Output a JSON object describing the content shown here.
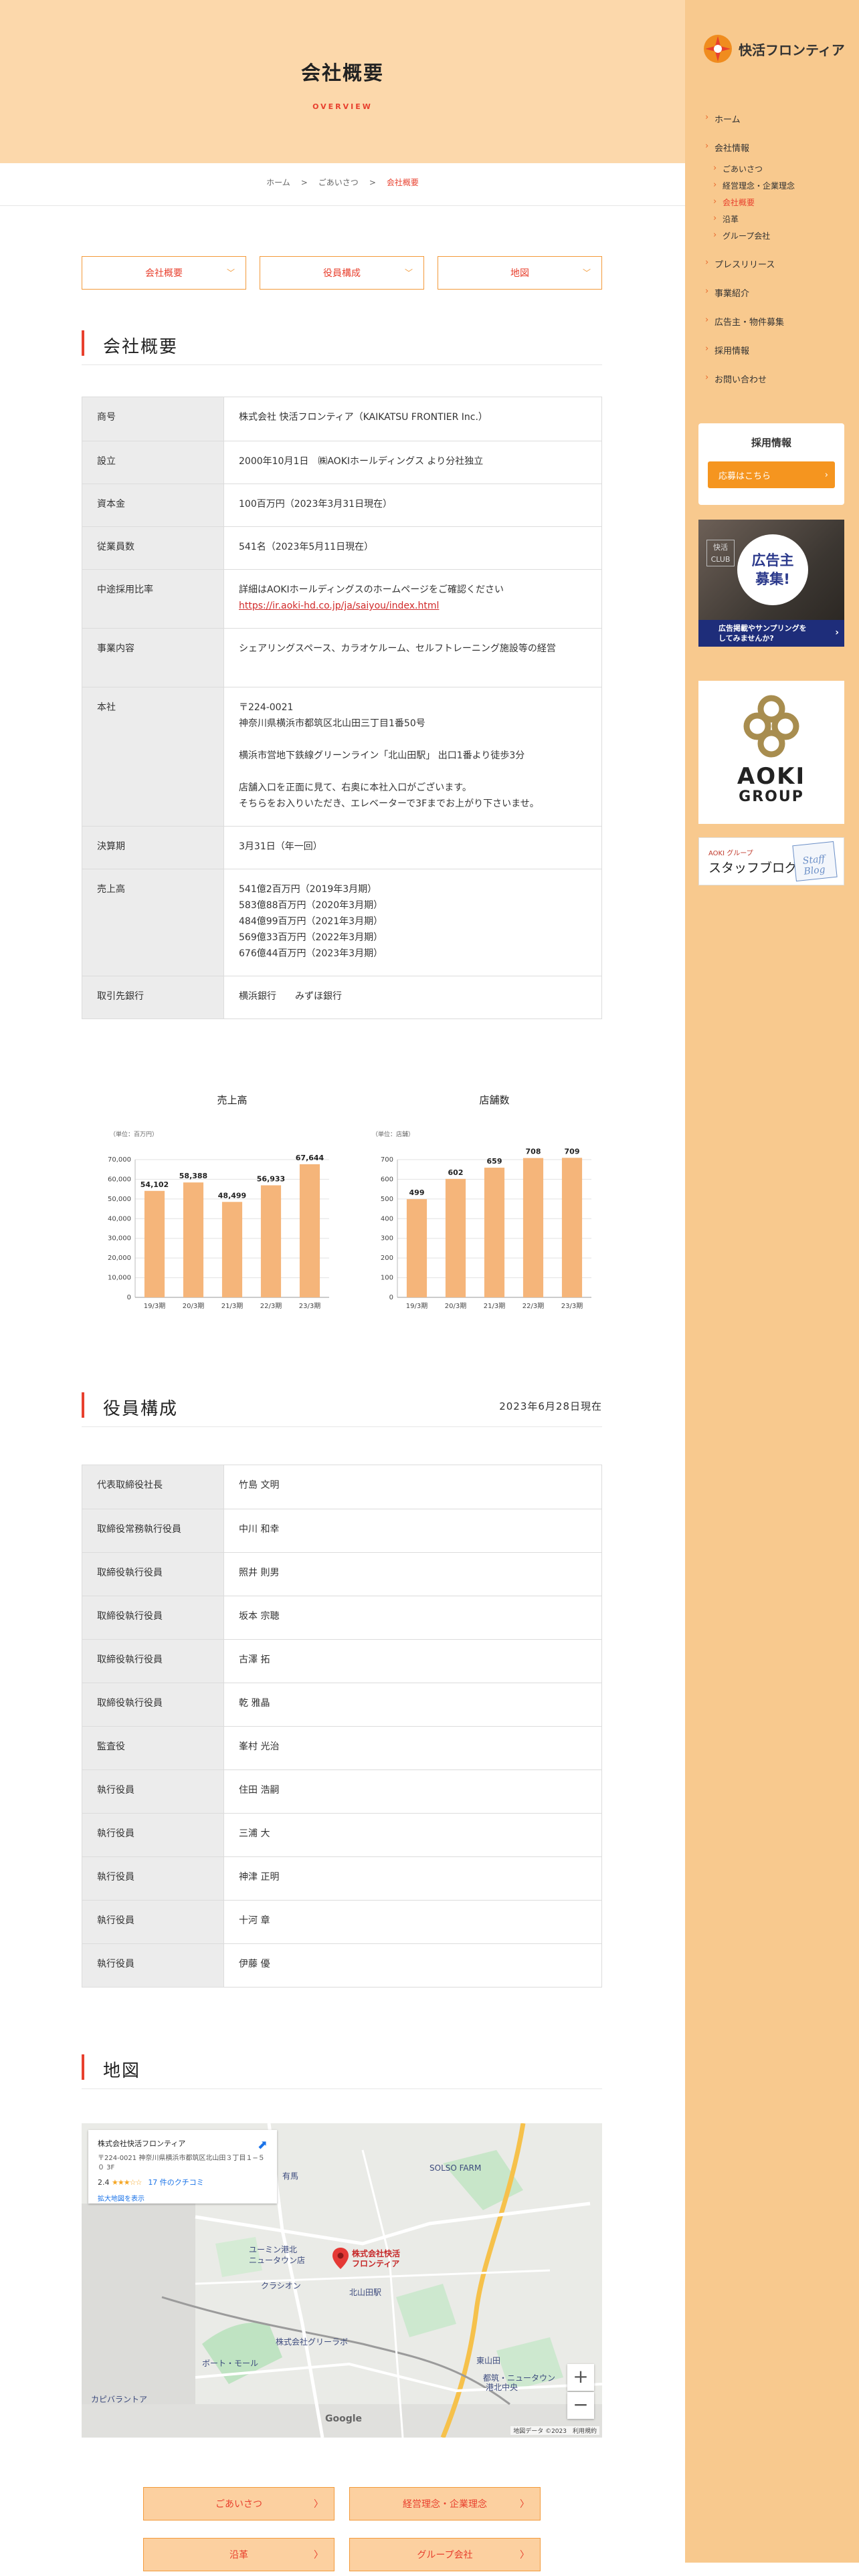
{
  "brand": {
    "name": "快活フロンティア"
  },
  "hero": {
    "title": "会社概要",
    "subtitle": "OVERVIEW"
  },
  "breadcrumb": {
    "items": [
      "ホーム",
      "ごあいさつ",
      "会社概要"
    ],
    "separator": ">"
  },
  "anchors": [
    {
      "label": "会社概要"
    },
    {
      "label": "役員構成"
    },
    {
      "label": "地図"
    }
  ],
  "nav": [
    {
      "label": "ホーム"
    },
    {
      "label": "会社情報"
    },
    {
      "label": "ごあいさつ"
    },
    {
      "label": "経営理念・企業理念"
    },
    {
      "label": "会社概要"
    },
    {
      "label": "沿革"
    },
    {
      "label": "グループ会社"
    },
    {
      "label": "プレスリリース"
    },
    {
      "label": "事業紹介"
    },
    {
      "label": "広告主・物件募集"
    },
    {
      "label": "採用情報"
    },
    {
      "label": "お問い合わせ"
    }
  ],
  "recruit": {
    "title": "採用情報",
    "button": "応募はこちら"
  },
  "ad_banner": {
    "tag": "快活 CLUB",
    "headline_1": "広告主",
    "headline_2": "募集!",
    "bar_1": "広告掲載やサンプリングを",
    "bar_2": "してみませんか?"
  },
  "aoki": {
    "name": "AOKI",
    "group": "GROUP"
  },
  "blog": {
    "sub": "AOKI グループ",
    "title": "スタッフブログ",
    "deco": "Staff Blog"
  },
  "overview": {
    "heading": "会社概要",
    "rows": [
      {
        "key": "商号",
        "value": "株式会社 快活フロンティア（KAIKATSU FRONTIER Inc.）"
      },
      {
        "key": "設立",
        "value": "2000年10月1日　㈱AOKIホールディングス より分社独立"
      },
      {
        "key": "資本金",
        "value": "100百万円（2023年3月31日現在）"
      },
      {
        "key": "従業員数",
        "value": "541名（2023年5月11日現在）"
      },
      {
        "key": "中途採用比率",
        "value": "詳細はAOKIホールディングスのホームページをご確認ください",
        "link": "https://ir.aoki-hd.co.jp/ja/saiyou/index.html"
      },
      {
        "key": "事業内容",
        "value": "シェアリングスペース、カラオケルーム、セルフトレーニング施設等の経営"
      },
      {
        "key": "本社",
        "value": "〒224-0021\n神奈川県横浜市都筑区北山田三丁目1番50号\n\n横浜市営地下鉄線グリーンライン「北山田駅」 出口1番より徒歩3分\n\n店舗入口を正面に見て、右奥に本社入口がございます。\nそちらをお入りいただき、エレベーターで3Fまでお上がり下さいませ。"
      },
      {
        "key": "決算期",
        "value": "3月31日（年一回）"
      },
      {
        "key": "売上高",
        "value": "541億2百万円（2019年3月期）\n583億88百万円（2020年3月期）\n484億99百万円（2021年3月期）\n569億33百万円（2022年3月期）\n676億44百万円（2023年3月期）"
      },
      {
        "key": "取引先銀行",
        "value": "横浜銀行　　みずほ銀行"
      }
    ]
  },
  "chart_data": [
    {
      "type": "bar",
      "title": "売上高",
      "unit_label": "（単位：百万円）",
      "categories": [
        "19/3期",
        "20/3期",
        "21/3期",
        "22/3期",
        "23/3期"
      ],
      "values": [
        54102,
        58388,
        48499,
        56933,
        67644
      ],
      "value_labels": [
        "54,102",
        "58,388",
        "48,499",
        "56,933",
        "67,644"
      ],
      "ylim": [
        0,
        70000
      ],
      "yticks": [
        0,
        10000,
        20000,
        30000,
        40000,
        50000,
        60000,
        70000
      ],
      "ytick_labels": [
        "0",
        "10,000",
        "20,000",
        "30,000",
        "40,000",
        "50,000",
        "60,000",
        "70,000"
      ],
      "grid": true,
      "color": "#f5b57a"
    },
    {
      "type": "bar",
      "title": "店舗数",
      "unit_label": "（単位：店舗）",
      "categories": [
        "19/3期",
        "20/3期",
        "21/3期",
        "22/3期",
        "23/3期"
      ],
      "values": [
        499,
        602,
        659,
        708,
        709
      ],
      "value_labels": [
        "499",
        "602",
        "659",
        "708",
        "709"
      ],
      "ylim": [
        0,
        700
      ],
      "yticks": [
        0,
        100,
        200,
        300,
        400,
        500,
        600,
        700
      ],
      "ytick_labels": [
        "0",
        "100",
        "200",
        "300",
        "400",
        "500",
        "600",
        "700"
      ],
      "grid": true,
      "color": "#f5b57a"
    }
  ],
  "officers": {
    "heading": "役員構成",
    "as_of": "2023年6月28日現在",
    "rows": [
      {
        "key": "代表取締役社長",
        "value": "竹島 文明"
      },
      {
        "key": "取締役常務執行役員",
        "value": "中川 和幸"
      },
      {
        "key": "取締役執行役員",
        "value": "照井 則男"
      },
      {
        "key": "取締役執行役員",
        "value": "坂本 宗聴"
      },
      {
        "key": "取締役執行役員",
        "value": "古澤 拓"
      },
      {
        "key": "取締役執行役員",
        "value": "乾 雅晶"
      },
      {
        "key": "監査役",
        "value": "峯村 光治"
      },
      {
        "key": "執行役員",
        "value": "住田 浩嗣"
      },
      {
        "key": "執行役員",
        "value": "三浦 大"
      },
      {
        "key": "執行役員",
        "value": "神津 正明"
      },
      {
        "key": "執行役員",
        "value": "十河 章"
      },
      {
        "key": "執行役員",
        "value": "伊藤 優"
      }
    ]
  },
  "map": {
    "heading": "地図",
    "info_name": "株式会社快活フロンティア",
    "info_address": "〒224-0021 神奈川県横浜市都筑区北山田３丁目１−５０ 3F",
    "info_rating": "2.4",
    "info_stars": "★★★☆☆",
    "info_reviews": "17 件のクチコミ",
    "info_link": "拡大地図を表示",
    "pin_label_1": "株式会社快活",
    "pin_label_2": "フロンティア",
    "labels": [
      "SOLSO FARM",
      "ユーミン港北",
      "ニュータウン店",
      "北山田駅",
      "クラシオン",
      "株式会社グリーラボ",
      "ボート・モール",
      "東山田",
      "都筑・ニュータウン",
      "港北中央",
      "カピバラントア",
      "有馬"
    ],
    "zoom_in": "+",
    "zoom_out": "−",
    "google": "Google",
    "footer": "地図データ ©2023　利用規約"
  },
  "bottom_links": [
    {
      "label": "ごあいさつ"
    },
    {
      "label": "経営理念・企業理念"
    },
    {
      "label": "沿革"
    },
    {
      "label": "グループ会社"
    }
  ]
}
